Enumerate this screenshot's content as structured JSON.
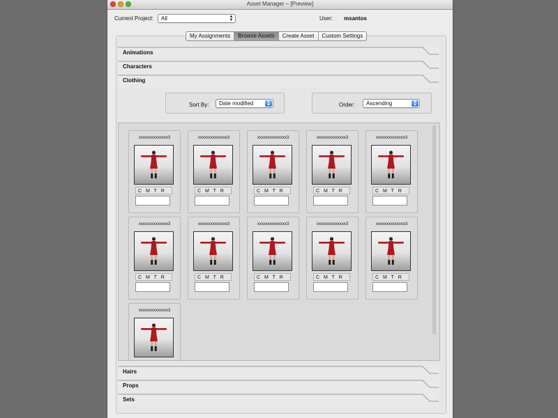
{
  "window": {
    "title": "Asset Manager – [Preview]"
  },
  "header": {
    "project_label": "Current Project:",
    "project_value": "All",
    "user_label": "User:",
    "user_value": "msantos"
  },
  "tabs": [
    {
      "label": "My Assignments",
      "active": false
    },
    {
      "label": "Browse Assets",
      "active": true
    },
    {
      "label": "Create Asset",
      "active": false
    },
    {
      "label": "Custom Settings",
      "active": false
    }
  ],
  "sections": {
    "animations": "Animations",
    "characters": "Characters",
    "clothing": "Clothing",
    "hairs": "Hairs",
    "props": "Props",
    "sets": "Sets"
  },
  "sort": {
    "sort_label": "Sort By:",
    "sort_value": "Date modified",
    "order_label": "Order:",
    "order_value": "Ascending"
  },
  "assets": [
    {
      "name": "xxxxxxxxxxxxxx3",
      "flags": "CMTRE",
      "input": ""
    },
    {
      "name": "xxxxxxxxxxxxxx3",
      "flags": "CMTRE",
      "input": ""
    },
    {
      "name": "xxxxxxxxxxxxxx3",
      "flags": "CMTRE",
      "input": ""
    },
    {
      "name": "xxxxxxxxxxxxxx3",
      "flags": "CMTRE",
      "input": ""
    },
    {
      "name": "xxxxxxxxxxxxxx3",
      "flags": "CMTRE",
      "input": ""
    },
    {
      "name": "xxxxxxxxxxxxxx3",
      "flags": "CMTRE",
      "input": ""
    },
    {
      "name": "xxxxxxxxxxxxxx3",
      "flags": "CMTRE",
      "input": ""
    },
    {
      "name": "xxxxxxxxxxxxxx3",
      "flags": "CMTRE",
      "input": ""
    },
    {
      "name": "xxxxxxxxxxxxxx3",
      "flags": "CMTRE",
      "input": ""
    },
    {
      "name": "xxxxxxxxxxxxxx3",
      "flags": "CMTRE",
      "input": ""
    },
    {
      "name": "xxxxxxxxxxxxxx3",
      "flags": "CMTRE",
      "input": ""
    }
  ],
  "colors": {
    "figure_dress": "#b01820",
    "tab_active": "#9a9a9a",
    "select_arrow": "#2f72d8"
  }
}
